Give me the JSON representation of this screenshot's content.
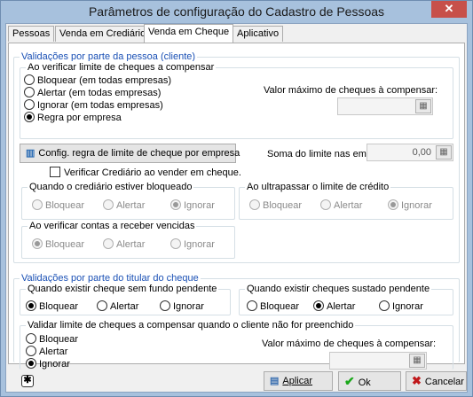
{
  "window": {
    "title": "Parâmetros de configuração do Cadastro de Pessoas",
    "close": "✕"
  },
  "tabs": [
    "Pessoas",
    "Venda em Crediário",
    "Venda em Cheque",
    "Aplicativo"
  ],
  "active_tab": "Venda em Cheque",
  "group_pessoa": {
    "legend": "Validações por parte da pessoa (cliente)",
    "subgroup_legend": "Ao verificar limite de cheques a compensar",
    "options": [
      "Bloquear (em todas empresas)",
      "Alertar (em todas empresas)",
      "Ignorar (em todas empresas)",
      "Regra por empresa"
    ],
    "selected": 3,
    "max_label": "Valor máximo de cheques à compensar:",
    "max_value": "",
    "config_button": "Config. regra de limite de cheque por empresa",
    "soma_label": "Soma do limite nas empresas:",
    "soma_value": "0,00",
    "verificar_crediario": "Verificar Crediário ao vender em cheque.",
    "bloqueado": {
      "legend": "Quando o crediário estiver bloqueado",
      "options": [
        "Bloquear",
        "Alertar",
        "Ignorar"
      ],
      "selected": 2
    },
    "ultrapassar": {
      "legend": "Ao ultrapassar o limite de crédito",
      "options": [
        "Bloquear",
        "Alertar",
        "Ignorar"
      ],
      "selected": 2
    },
    "vencidas": {
      "legend": "Ao verificar contas a receber vencidas",
      "options": [
        "Bloquear",
        "Alertar",
        "Ignorar"
      ],
      "selected": 0
    }
  },
  "group_titular": {
    "legend": "Validações por parte do titular do cheque",
    "sem_fundo": {
      "legend": "Quando existir cheque sem fundo pendente",
      "options": [
        "Bloquear",
        "Alertar",
        "Ignorar"
      ],
      "selected": 0
    },
    "sustado": {
      "legend": "Quando existir cheques sustado pendente",
      "options": [
        "Bloquear",
        "Alertar",
        "Ignorar"
      ],
      "selected": 1
    },
    "limite_vazio": {
      "legend": "Validar limite de cheques a compensar quando o cliente não for preenchido",
      "options": [
        "Bloquear",
        "Alertar",
        "Ignorar"
      ],
      "selected": 2
    },
    "max_label": "Valor máximo de cheques à compensar:",
    "max_value": ""
  },
  "footer": {
    "apply": "Aplicar",
    "ok": "Ok",
    "cancel": "Cancelar"
  }
}
